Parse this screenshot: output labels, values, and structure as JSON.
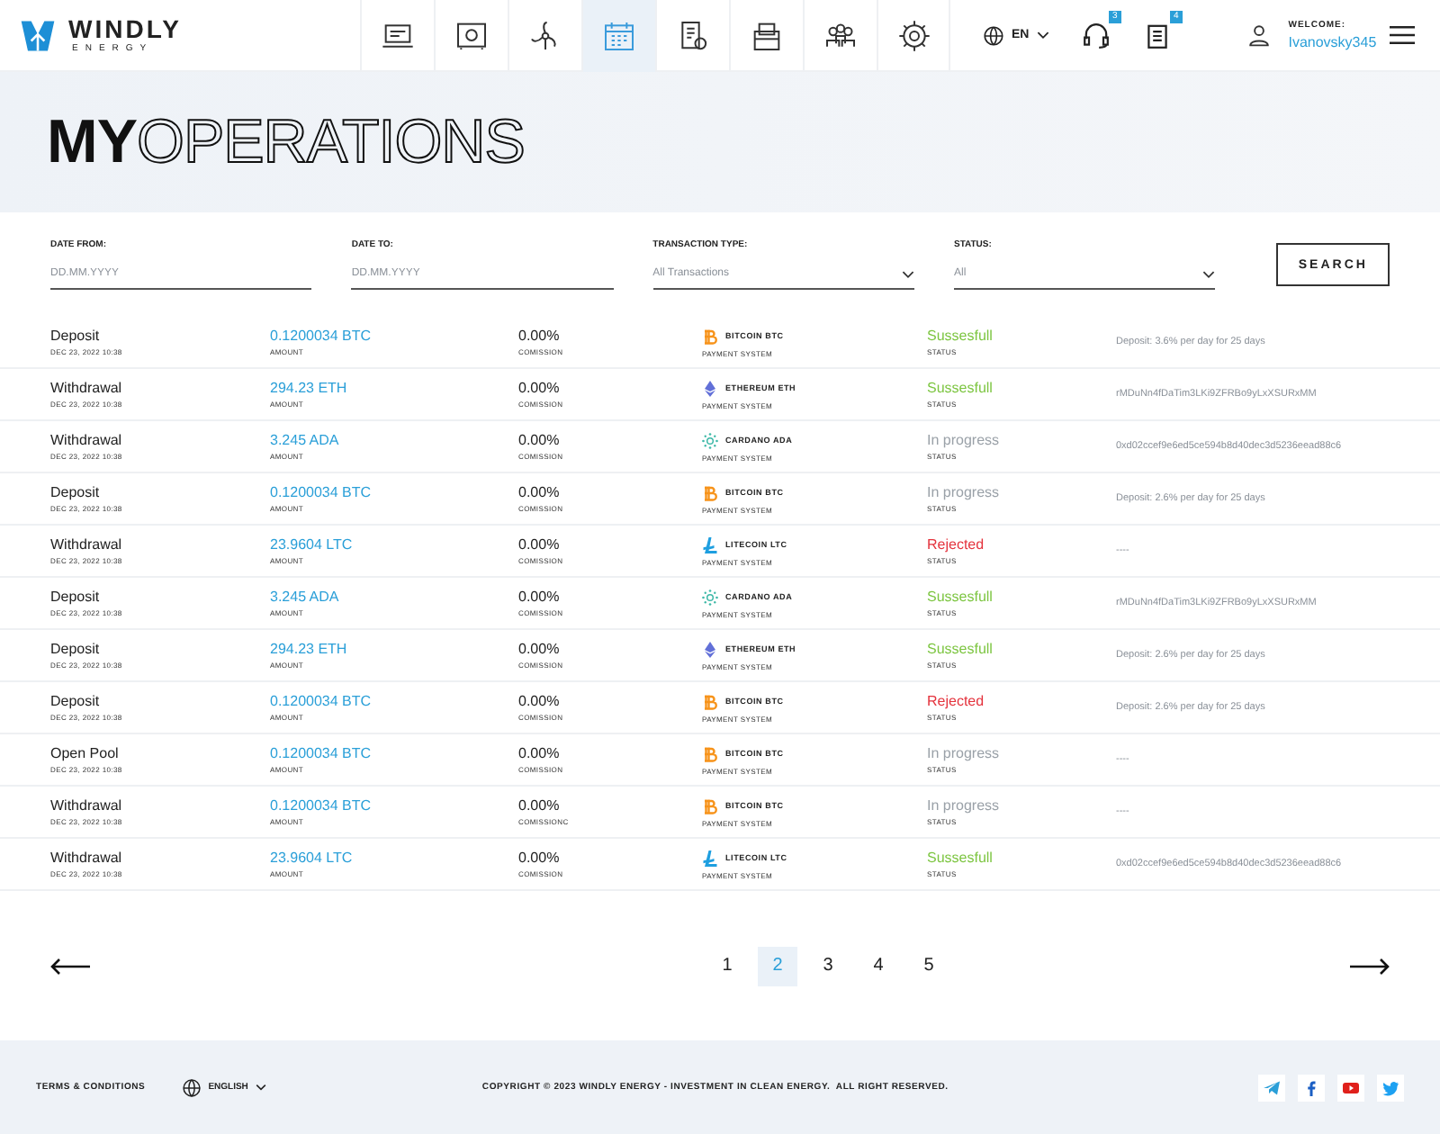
{
  "brand": {
    "name": "WINDLY",
    "tagline": "ENERGY"
  },
  "nav": [
    {
      "kind": "laptop",
      "selected": false
    },
    {
      "kind": "safe",
      "selected": false
    },
    {
      "kind": "turbine",
      "selected": false
    },
    {
      "kind": "calendar",
      "selected": true
    },
    {
      "kind": "receipt",
      "selected": false
    },
    {
      "kind": "case",
      "selected": false
    },
    {
      "kind": "people",
      "selected": false
    },
    {
      "kind": "gear",
      "selected": false
    }
  ],
  "language": "EN",
  "support_badge": "3",
  "documents_badge": "4",
  "user": {
    "greeting": "WELCOME:",
    "name": "Ivanovsky345"
  },
  "hero": {
    "title_bold": "MY",
    "title_outline": "OPERATIONS"
  },
  "filters": [
    {
      "kind": "text",
      "label": "DATE FROM:",
      "placeholder": "DD.MM.YYYY"
    },
    {
      "kind": "text",
      "label": "DATE TO:",
      "placeholder": "DD.MM.YYYY"
    },
    {
      "kind": "select",
      "label": "TRANSACTION TYPE:",
      "value": "All Transactions"
    },
    {
      "kind": "select",
      "label": "STATUS:",
      "value": "All"
    }
  ],
  "search_button": "SEARCH",
  "rows": [
    {
      "type": "Deposit",
      "date": "DEC 23, 2022 10:38",
      "amount": "0.1200034 BTC",
      "amount_label": "AMOUNT",
      "commission": "0.00%",
      "commission_label": "COMISSION",
      "payment": {
        "kind": "btc",
        "name": "BITCOIN BTC",
        "label": "PAYMENT SYSTEM"
      },
      "status": {
        "kind": "success",
        "text": "Sussesfull",
        "label": "STATUS"
      },
      "details": "Deposit: 3.6% per day for 25 days"
    },
    {
      "type": "Withdrawal",
      "date": "DEC 23, 2022 10:38",
      "amount": "294.23 ETH",
      "amount_label": "AMOUNT",
      "commission": "0.00%",
      "commission_label": "COMISSION",
      "payment": {
        "kind": "eth",
        "name": "ETHEREUM ETH",
        "label": "PAYMENT SYSTEM"
      },
      "status": {
        "kind": "success",
        "text": "Sussesfull",
        "label": "STATUS"
      },
      "details": "rMDuNn4fDaTim3LKi9ZFRBo9yLxXSURxMM"
    },
    {
      "type": "Withdrawal",
      "date": "DEC 23, 2022 10:38",
      "amount": "3.245 ADA",
      "amount_label": "AMOUNT",
      "commission": "0.00%",
      "commission_label": "COMISSION",
      "payment": {
        "kind": "ada",
        "name": "CARDANO ADA",
        "label": "PAYMENT SYSTEM"
      },
      "status": {
        "kind": "progress",
        "text": "In progress",
        "label": "STATUS"
      },
      "details": "0xd02ccef9e6ed5ce594b8d40dec3d5236eead88c6"
    },
    {
      "type": "Deposit",
      "date": "DEC 23, 2022 10:38",
      "amount": "0.1200034 BTC",
      "amount_label": "AMOUNT",
      "commission": "0.00%",
      "commission_label": "COMISSION",
      "payment": {
        "kind": "btc",
        "name": "BITCOIN BTC",
        "label": "PAYMENT SYSTEM"
      },
      "status": {
        "kind": "progress",
        "text": "In progress",
        "label": "STATUS"
      },
      "details": "Deposit: 2.6% per day for 25 days"
    },
    {
      "type": "Withdrawal",
      "date": "DEC 23, 2022 10:38",
      "amount": "23.9604 LTC",
      "amount_label": "AMOUNT",
      "commission": "0.00%",
      "commission_label": "COMISSION",
      "payment": {
        "kind": "ltc",
        "name": "LITECOIN LTC",
        "label": "PAYMENT SYSTEM"
      },
      "status": {
        "kind": "rejected",
        "text": "Rejected",
        "label": "STATUS"
      },
      "details": "----"
    },
    {
      "type": "Deposit",
      "date": "DEC 23, 2022 10:38",
      "amount": "3.245 ADA",
      "amount_label": "AMOUNT",
      "commission": "0.00%",
      "commission_label": "COMISSION",
      "payment": {
        "kind": "ada",
        "name": "CARDANO ADA",
        "label": "PAYMENT SYSTEM"
      },
      "status": {
        "kind": "success",
        "text": "Sussesfull",
        "label": "STATUS"
      },
      "details": "rMDuNn4fDaTim3LKi9ZFRBo9yLxXSURxMM"
    },
    {
      "type": "Deposit",
      "date": "DEC 23, 2022 10:38",
      "amount": "294.23 ETH",
      "amount_label": "AMOUNT",
      "commission": "0.00%",
      "commission_label": "COMISSION",
      "payment": {
        "kind": "eth",
        "name": "ETHEREUM ETH",
        "label": "PAYMENT SYSTEM"
      },
      "status": {
        "kind": "success",
        "text": "Sussesfull",
        "label": "STATUS"
      },
      "details": "Deposit: 2.6% per day for 25 days"
    },
    {
      "type": "Deposit",
      "date": "DEC 23, 2022 10:38",
      "amount": "0.1200034 BTC",
      "amount_label": "AMOUNT",
      "commission": "0.00%",
      "commission_label": "COMISSION",
      "payment": {
        "kind": "btc",
        "name": "BITCOIN BTC",
        "label": "PAYMENT SYSTEM"
      },
      "status": {
        "kind": "rejected",
        "text": "Rejected",
        "label": "STATUS"
      },
      "details": "Deposit: 2.6% per day for 25 days"
    },
    {
      "type": "Open Pool",
      "date": "DEC 23, 2022 10:38",
      "amount": "0.1200034 BTC",
      "amount_label": "AMOUNT",
      "commission": "0.00%",
      "commission_label": "COMISSION",
      "payment": {
        "kind": "btc",
        "name": "BITCOIN BTC",
        "label": "PAYMENT SYSTEM"
      },
      "status": {
        "kind": "progress",
        "text": "In progress",
        "label": "STATUS"
      },
      "details": "----"
    },
    {
      "type": "Withdrawal",
      "date": "DEC 23, 2022 10:38",
      "amount": "0.1200034 BTC",
      "amount_label": "AMOUNT",
      "commission": "0.00%",
      "commission_label": "COMISSIONC",
      "payment": {
        "kind": "btc",
        "name": "BITCOIN BTC",
        "label": "PAYMENT SYSTEM"
      },
      "status": {
        "kind": "progress",
        "text": "In progress",
        "label": "STATUS"
      },
      "details": "----"
    },
    {
      "type": "Withdrawal",
      "date": "DEC 23, 2022 10:38",
      "amount": "23.9604 LTC",
      "amount_label": "AMOUNT",
      "commission": "0.00%",
      "commission_label": "COMISSION",
      "payment": {
        "kind": "ltc",
        "name": "LITECOIN LTC",
        "label": "PAYMENT SYSTEM"
      },
      "status": {
        "kind": "success",
        "text": "Sussesfull",
        "label": "STATUS"
      },
      "details": "0xd02ccef9e6ed5ce594b8d40dec3d5236eead88c6"
    }
  ],
  "pages": [
    {
      "label": "1",
      "selected": false
    },
    {
      "label": "2",
      "selected": true
    },
    {
      "label": "3",
      "selected": false
    },
    {
      "label": "4",
      "selected": false
    },
    {
      "label": "5",
      "selected": false
    }
  ],
  "footer": {
    "terms": "TERMS & CONDITIONS",
    "language": "ENGLISH",
    "copyright": "COPYRIGHT © 2023 WINDLY ENERGY - INVESTMENT IN CLEAN ENERGY.  ALL RIGHT RESERVED.",
    "social": [
      {
        "kind": "telegram",
        "color": "#2a9fd8"
      },
      {
        "kind": "facebook",
        "color": "#1b5fc4"
      },
      {
        "kind": "youtube",
        "color": "#e0201b"
      },
      {
        "kind": "twitter",
        "color": "#1da1f2"
      }
    ]
  }
}
